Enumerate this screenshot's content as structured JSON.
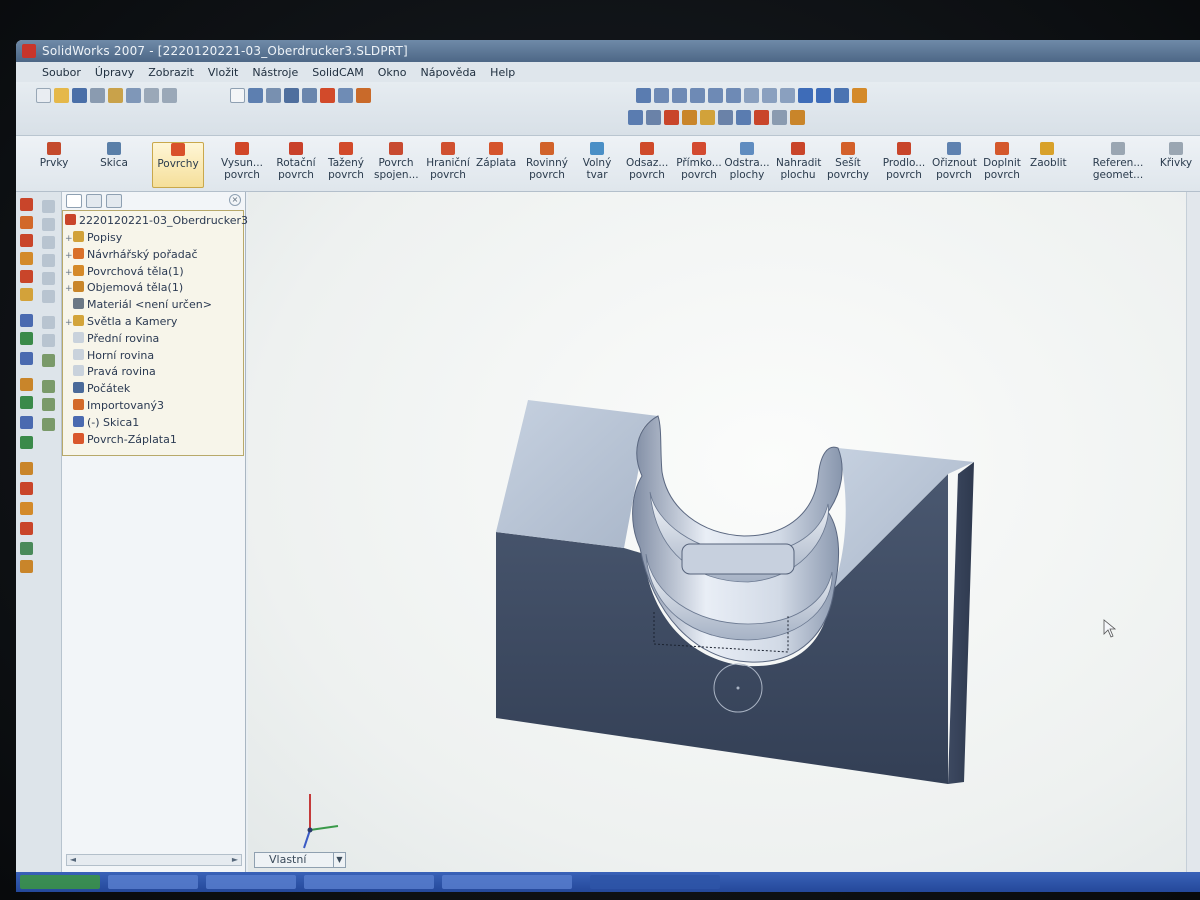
{
  "window": {
    "title": "SolidWorks 2007 - [2220120221-03_Oberdrucker3.SLDPRT]"
  },
  "menubar": {
    "items": [
      "Soubor",
      "Úpravy",
      "Zobrazit",
      "Vložit",
      "Nástroje",
      "SolidCAM",
      "Okno",
      "Nápověda",
      "Help"
    ]
  },
  "commandbar": {
    "items": [
      {
        "label": "Prvky",
        "sub": "",
        "color": "#c44a2c"
      },
      {
        "label": "Skica",
        "sub": "",
        "color": "#5a7fa8"
      },
      {
        "label": "Povrchy",
        "sub": "",
        "color": "#d9512a"
      },
      {
        "label": "Vysun...",
        "sub": "povrch",
        "color": "#d14628"
      },
      {
        "label": "Rotační",
        "sub": "povrch",
        "color": "#c9412a"
      },
      {
        "label": "Tažený",
        "sub": "povrch",
        "color": "#d24a2a"
      },
      {
        "label": "Povrch",
        "sub": "spojen...",
        "color": "#c84a30"
      },
      {
        "label": "Hraniční",
        "sub": "povrch",
        "color": "#d05030"
      },
      {
        "label": "Záplata",
        "sub": "",
        "color": "#d5542c"
      },
      {
        "label": "Rovinný",
        "sub": "povrch",
        "color": "#d1622a"
      },
      {
        "label": "Volný",
        "sub": "tvar",
        "color": "#4a8fc6"
      },
      {
        "label": "Odsaz...",
        "sub": "povrch",
        "color": "#cf4a2a"
      },
      {
        "label": "Přímko...",
        "sub": "povrch",
        "color": "#d34a30"
      },
      {
        "label": "Odstra...",
        "sub": "plochy",
        "color": "#5f8cc0"
      },
      {
        "label": "Nahradit",
        "sub": "plochu",
        "color": "#c9452a"
      },
      {
        "label": "Sešít",
        "sub": "povrchy",
        "color": "#d3602a"
      },
      {
        "label": "Prodlo...",
        "sub": "povrch",
        "color": "#c8452a"
      },
      {
        "label": "Ořiznout",
        "sub": "povrch",
        "color": "#5f82b0"
      },
      {
        "label": "Doplnit",
        "sub": "povrch",
        "color": "#d4582c"
      },
      {
        "label": "Zaoblit",
        "sub": "",
        "color": "#d8a12a"
      },
      {
        "label": "Referen...",
        "sub": "geomet...",
        "color": "#9aa6b2"
      },
      {
        "label": "Křivky",
        "sub": "",
        "color": "#9aa6b2"
      }
    ]
  },
  "tree": {
    "root": "2220120221-03_Oberdrucker3",
    "items": [
      {
        "label": "Popisy",
        "expand": "+",
        "color": "#d2a23a"
      },
      {
        "label": "Návrhářský pořadač",
        "expand": "+",
        "color": "#d9702a"
      },
      {
        "label": "Povrchová těla(1)",
        "expand": "+",
        "color": "#d58a2a"
      },
      {
        "label": "Objemová těla(1)",
        "expand": "+",
        "color": "#c9862a"
      },
      {
        "label": "Materiál <není určen>",
        "expand": "",
        "color": "#6b7886"
      },
      {
        "label": "Světla a Kamery",
        "expand": "+",
        "color": "#d3a43a"
      },
      {
        "label": "Přední rovina",
        "expand": "",
        "color": "#c9d2dc"
      },
      {
        "label": "Horní rovina",
        "expand": "",
        "color": "#c9d2dc"
      },
      {
        "label": "Pravá rovina",
        "expand": "",
        "color": "#c9d2dc"
      },
      {
        "label": "Počátek",
        "expand": "",
        "color": "#4a6a9a"
      },
      {
        "label": "Importovaný3",
        "expand": "",
        "color": "#d36a2a"
      },
      {
        "label": "(-) Skica1",
        "expand": "",
        "color": "#4a6ab0"
      },
      {
        "label": "Povrch-Záplata1",
        "expand": "",
        "color": "#d9572c"
      }
    ]
  },
  "viewport": {
    "view_orientation": "Vlastní",
    "model_colors": {
      "top_face": "#b9c5d6",
      "front_face": "#3d4a60",
      "side_face": "#36425a",
      "highlight": "#eef2f8"
    }
  },
  "colors": {
    "accent": "#d9512a",
    "tree_highlight_border": "#b8a96a",
    "taskbar": "#2a4fa6"
  }
}
